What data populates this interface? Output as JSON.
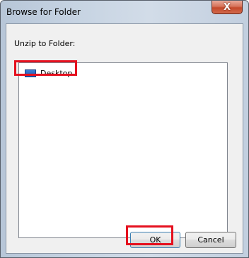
{
  "window": {
    "title": "Browse for Folder",
    "close_icon": "X"
  },
  "dialog": {
    "prompt": "Unzip to Folder:",
    "tree_items": [
      {
        "label": "Desktop",
        "icon": "desktop-folder-icon"
      }
    ],
    "ok_label": "OK",
    "cancel_label": "Cancel"
  },
  "colors": {
    "highlight": "#e5101e",
    "close_button": "#c4482a",
    "folder_icon": "#1c56b3"
  }
}
